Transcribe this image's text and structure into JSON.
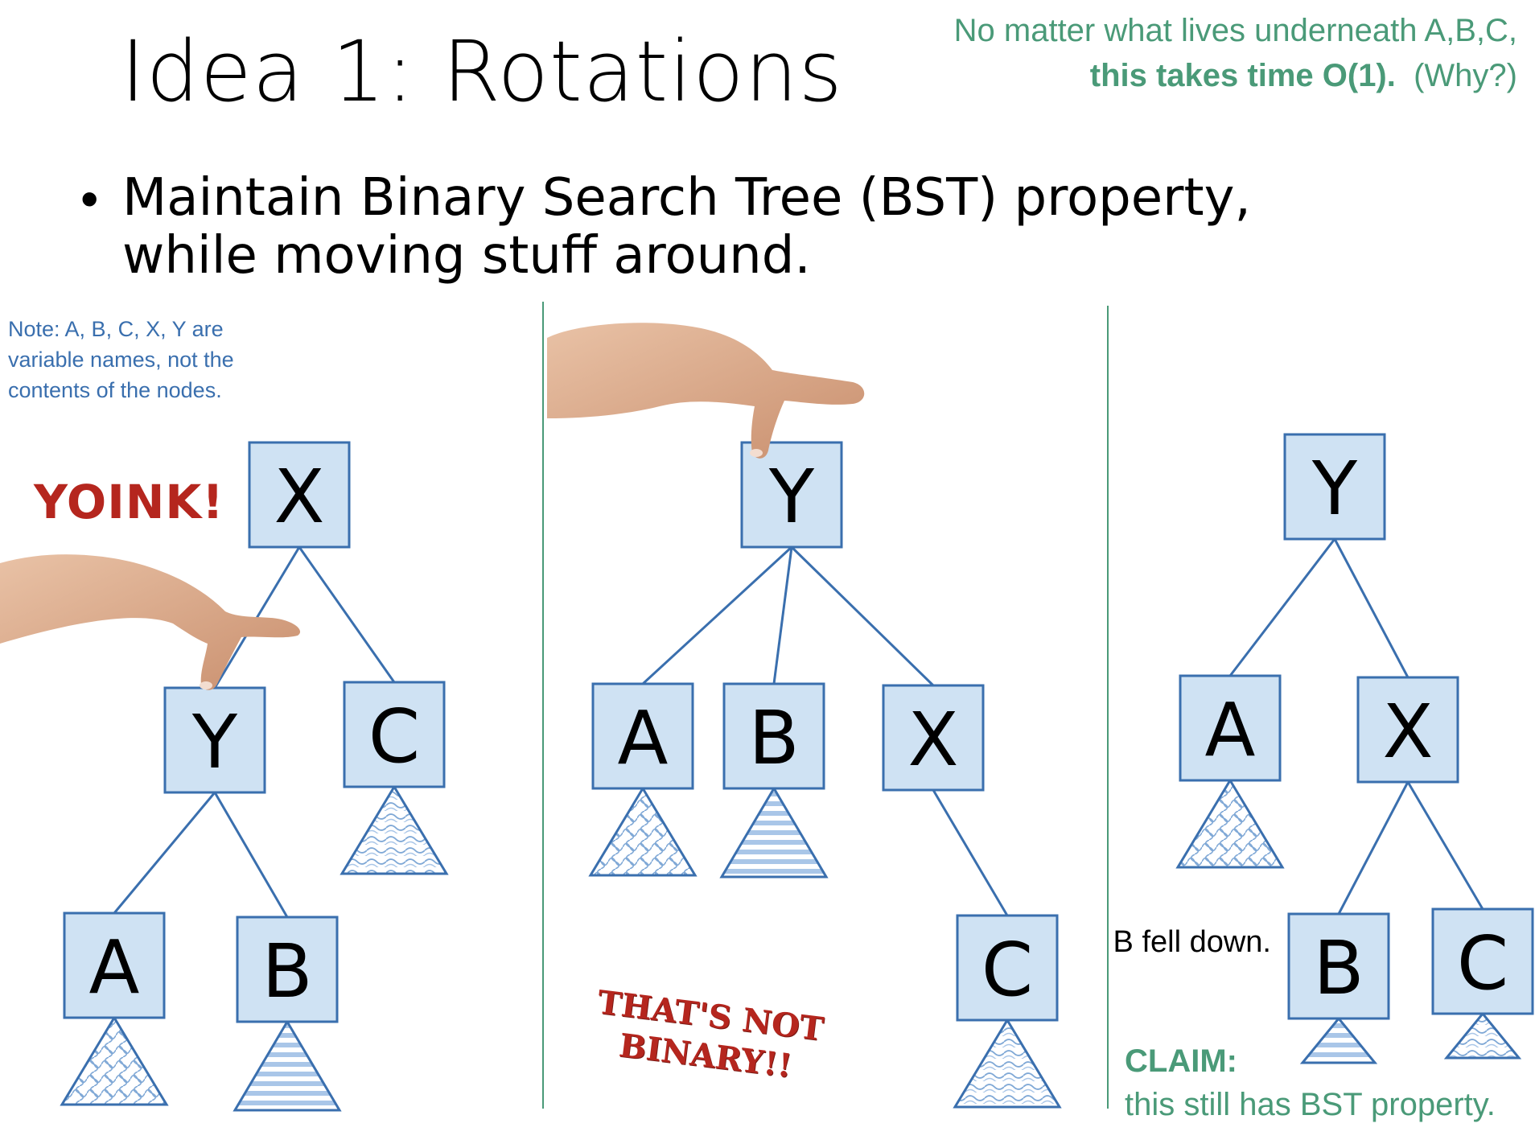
{
  "title": "Idea 1: Rotations",
  "top_note": {
    "line1": "No matter what lives underneath A,B,C,",
    "line2_bold": "this takes time O(1).",
    "line2_rest": "(Why?)"
  },
  "bullet": "Maintain Binary Search Tree (BST) property, while moving stuff around.",
  "variable_note": "Note: A, B, C, X, Y are variable names, not the contents of the nodes.",
  "yoink": "YOINK!",
  "not_binary": "THAT'S NOT BINARY!!",
  "b_fell": "B fell down.",
  "claim_label": "CLAIM:",
  "claim_text": "this still has BST property.",
  "colors": {
    "node_fill": "#cfe2f3",
    "node_stroke": "#3a6fae",
    "edge": "#3a6fae",
    "accent_green": "#4a9a78",
    "accent_red": "#b5261e",
    "divider": "#4a9a78"
  },
  "panels": [
    {
      "nodes": [
        {
          "id": "X",
          "label": "X",
          "subtree": null
        },
        {
          "id": "Y",
          "label": "Y",
          "subtree": null
        },
        {
          "id": "C",
          "label": "C",
          "subtree": "wave"
        },
        {
          "id": "A",
          "label": "A",
          "subtree": "mesh"
        },
        {
          "id": "B",
          "label": "B",
          "subtree": "stripes"
        }
      ],
      "edges": [
        [
          "X",
          "Y"
        ],
        [
          "X",
          "C"
        ],
        [
          "Y",
          "A"
        ],
        [
          "Y",
          "B"
        ]
      ]
    },
    {
      "nodes": [
        {
          "id": "Y",
          "label": "Y",
          "subtree": null
        },
        {
          "id": "A",
          "label": "A",
          "subtree": "mesh"
        },
        {
          "id": "B",
          "label": "B",
          "subtree": "stripes"
        },
        {
          "id": "X",
          "label": "X",
          "subtree": null
        },
        {
          "id": "C",
          "label": "C",
          "subtree": "wave"
        }
      ],
      "edges": [
        [
          "Y",
          "A"
        ],
        [
          "Y",
          "B"
        ],
        [
          "Y",
          "X"
        ],
        [
          "X",
          "C"
        ]
      ]
    },
    {
      "nodes": [
        {
          "id": "Y",
          "label": "Y",
          "subtree": null
        },
        {
          "id": "A",
          "label": "A",
          "subtree": "mesh"
        },
        {
          "id": "X",
          "label": "X",
          "subtree": null
        },
        {
          "id": "B",
          "label": "B",
          "subtree": "stripes"
        },
        {
          "id": "C",
          "label": "C",
          "subtree": "wave"
        }
      ],
      "edges": [
        [
          "Y",
          "A"
        ],
        [
          "Y",
          "X"
        ],
        [
          "X",
          "B"
        ],
        [
          "X",
          "C"
        ]
      ]
    }
  ]
}
